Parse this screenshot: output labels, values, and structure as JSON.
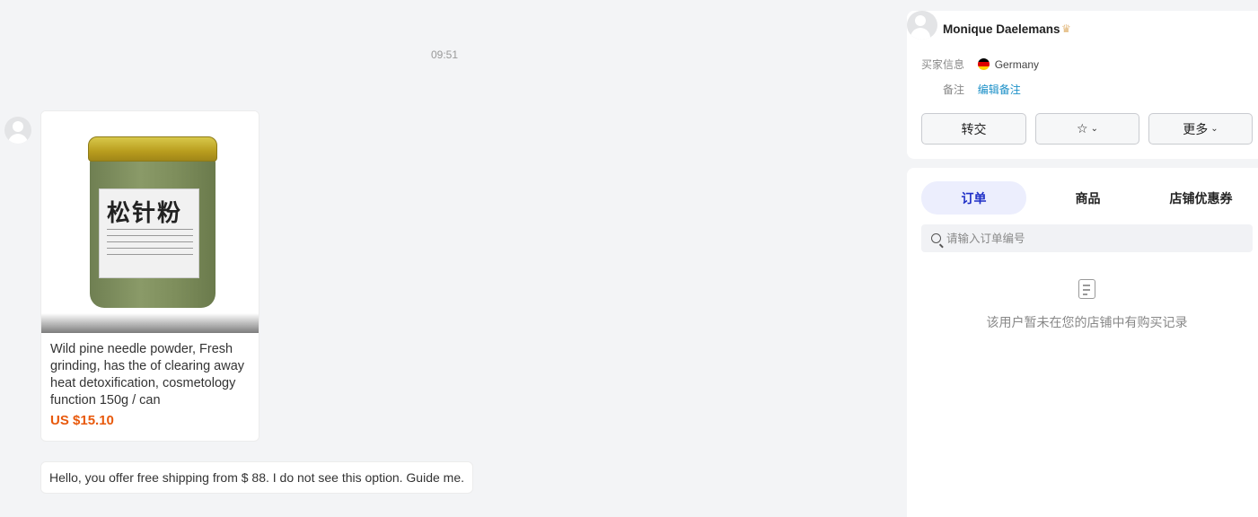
{
  "chat": {
    "timestamp": "09:51",
    "product": {
      "jar_label": "松针粉",
      "title": "Wild pine needle powder, Fresh grinding, has the of clearing away heat detoxification, cosmetology function 150g / can",
      "price": "US $15.10"
    },
    "message": "Hello, you offer free shipping from $ 88. I do not see this option. Guide me."
  },
  "customer": {
    "name": "Monique Daelemans",
    "buyer_info_label": "买家信息",
    "country": "Germany",
    "note_label": "备注",
    "edit_note": "编辑备注",
    "transfer_button": "转交",
    "more_button": "更多"
  },
  "tabs": [
    {
      "label": "订单",
      "active": true
    },
    {
      "label": "商品",
      "active": false
    },
    {
      "label": "店铺优惠券",
      "active": false
    }
  ],
  "search": {
    "placeholder": "请输入订单编号"
  },
  "empty_state": "该用户暂未在您的店铺中有购买记录",
  "colors": {
    "accent": "#1f2fc7",
    "price": "#e8590c",
    "link": "#1a8fc7"
  }
}
